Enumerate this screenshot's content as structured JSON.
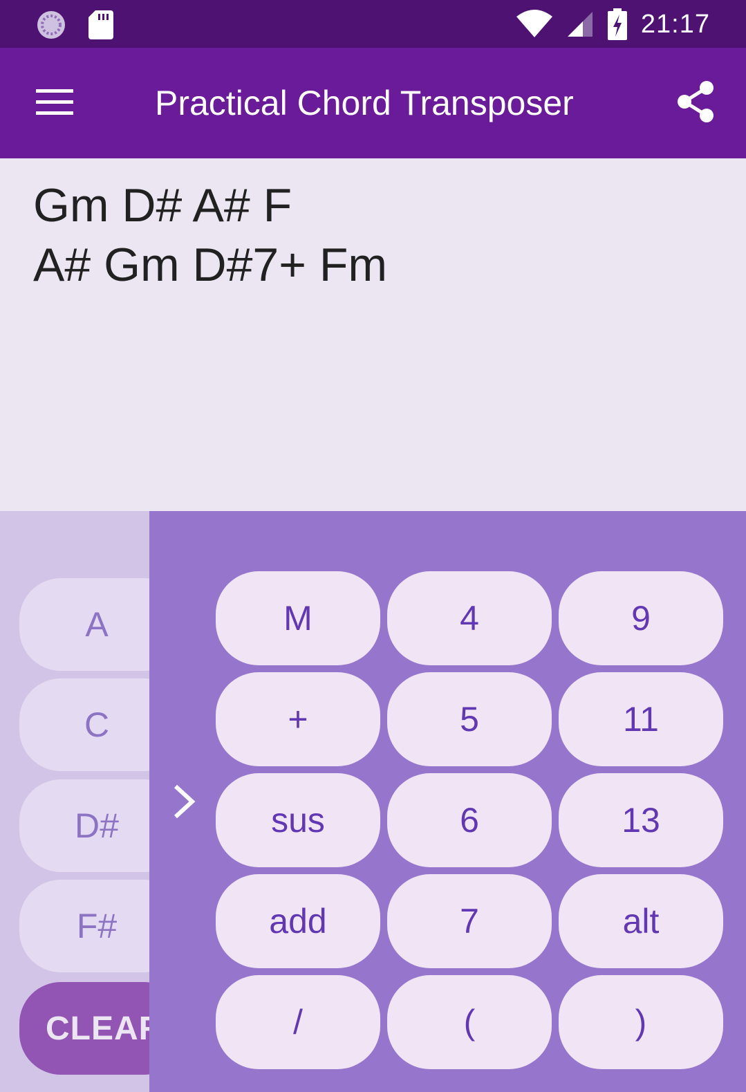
{
  "status_bar": {
    "time": "21:17",
    "icons": [
      "loading-icon",
      "sd-card-icon",
      "wifi-icon",
      "cell-signal-icon",
      "battery-charging-icon"
    ]
  },
  "app_bar": {
    "title": "Practical Chord Transposer",
    "menu_icon": "hamburger-menu-icon",
    "share_icon": "share-icon"
  },
  "chords": {
    "line1": "Gm D# A# F",
    "line2": "A# Gm D#7+ Fm"
  },
  "keyboard": {
    "notes": [
      "A",
      "C",
      "D#",
      "F#"
    ],
    "clear_label": "CLEAR",
    "chevron_icon": "chevron-right-icon",
    "modifiers": [
      [
        "M",
        "4",
        "9"
      ],
      [
        "+",
        "5",
        "11"
      ],
      [
        "sus",
        "6",
        "13"
      ],
      [
        "add",
        "7",
        "alt"
      ],
      [
        "/",
        "(",
        ")"
      ]
    ]
  },
  "colors": {
    "status_bar": "#4d1272",
    "app_bar": "#6a1b9a",
    "chord_background": "#ece6f3",
    "keyboard_left_bg": "#d2c4e6",
    "keyboard_right_bg": "#9676cc",
    "key_bg": "#f1e4f5",
    "key_text": "#6237b4",
    "clear_bg": "#9255b4"
  }
}
